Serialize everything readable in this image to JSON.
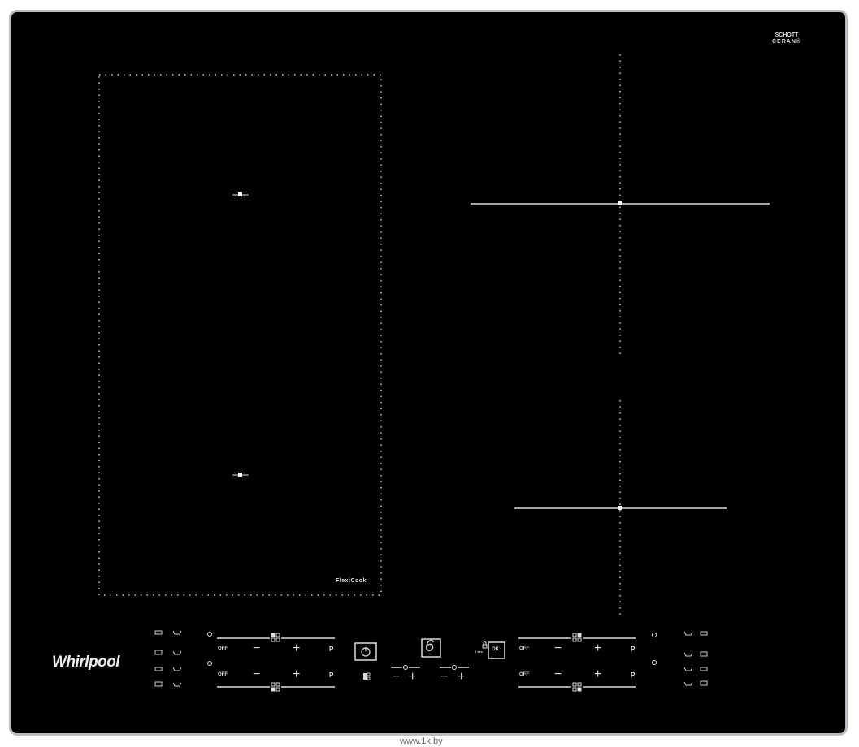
{
  "brand": {
    "logo_text": "Whirlpool",
    "glass_text_line1": "SCHOTT",
    "glass_text_line2": "CERAN®"
  },
  "zones": {
    "flexi_label": "FlexiCook"
  },
  "controls": {
    "off_label": "OFF",
    "minus": "−",
    "plus": "+",
    "p_label": "P",
    "lock_hold": "3 sec",
    "ok_label": "OK",
    "sixth_sense": "6",
    "icons": [
      "power-icon",
      "timer-icon",
      "lock-icon",
      "zone-selector-icon",
      "pot-icon",
      "pan-icon"
    ]
  },
  "watermark": "www.1k.by",
  "colors": {
    "glass": "#000000",
    "frame": "#b9bcc0",
    "print": "#dddddd"
  }
}
